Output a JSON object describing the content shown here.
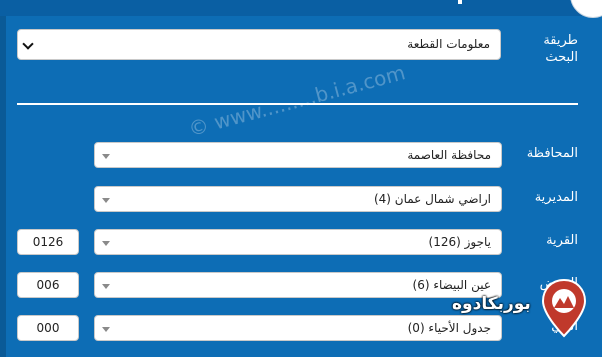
{
  "search": {
    "label": "طريقة البحث",
    "selected": "معلومات القطعة"
  },
  "watermark": "© www.........b.i.a.com",
  "fields": {
    "governorate": {
      "label": "المحافظة",
      "value": "محافظة العاصمة"
    },
    "directorate": {
      "label": "المديرية",
      "value": "اراضي شمال عمان (4)"
    },
    "village": {
      "label": "القرية",
      "value": "ياجوز (126)",
      "code": "0126"
    },
    "basin": {
      "label": "الحوض",
      "value": "عين البيضاء (6)",
      "code": "006"
    },
    "neighborhood": {
      "label": "الحي",
      "value": "جدول الأحياء (0)",
      "code": "000"
    }
  },
  "brand": {
    "text": "بوربكادوه"
  },
  "colors": {
    "background": "#0d6db5",
    "logo_red": "#c0392b"
  }
}
